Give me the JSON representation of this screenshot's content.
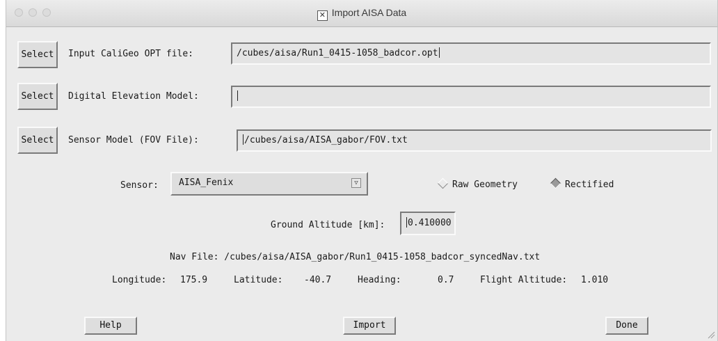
{
  "window": {
    "title": "Import AISA Data"
  },
  "rows": {
    "opt": {
      "select_label": "Select",
      "label": "Input CaliGeo OPT file:",
      "value": "/cubes/aisa/Run1_0415-1058_badcor.opt"
    },
    "dem": {
      "select_label": "Select",
      "label": "Digital Elevation Model:",
      "value": ""
    },
    "fov": {
      "select_label": "Select",
      "label": "Sensor Model (FOV File):",
      "value": "/cubes/aisa/AISA_gabor/FOV.txt"
    }
  },
  "sensor": {
    "label": "Sensor:",
    "selected": "AISA_Fenix",
    "radio_raw": "Raw Geometry",
    "radio_rect": "Rectified",
    "rectified_selected": true
  },
  "ground": {
    "label": "Ground Altitude [km]:",
    "value": "0.410000"
  },
  "nav": {
    "text": "Nav File: /cubes/aisa/AISA_gabor/Run1_0415-1058_badcor_syncedNav.txt"
  },
  "stats": {
    "lon_label": "Longitude:",
    "lon_value": "175.9",
    "lat_label": "Latitude:",
    "lat_value": "-40.7",
    "heading_label": "Heading:",
    "heading_value": "0.7",
    "alt_label": "Flight Altitude:",
    "alt_value": "1.010"
  },
  "buttons": {
    "help": "Help",
    "import": "Import",
    "done": "Done"
  }
}
